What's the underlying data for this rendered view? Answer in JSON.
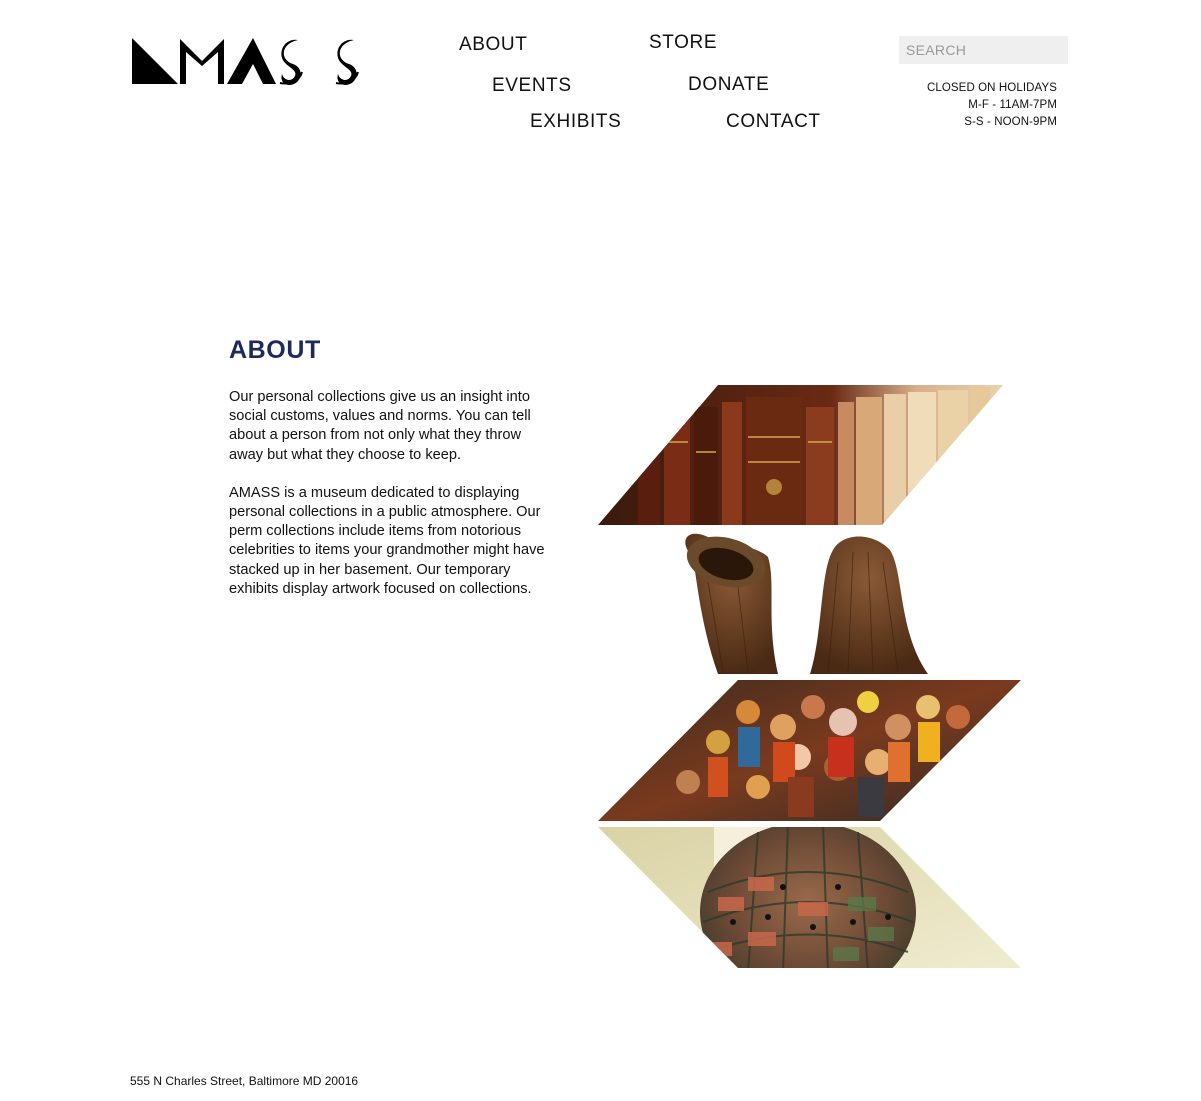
{
  "logo": {
    "text": "AMASS"
  },
  "nav": {
    "about": "ABOUT",
    "store": "STORE",
    "events": "EVENTS",
    "donate": "DONATE",
    "exhibits": "EXHIBITS",
    "contact": "CONTACT"
  },
  "search": {
    "placeholder": "SEARCH",
    "value": ""
  },
  "hours": {
    "line1": "CLOSED ON HOLIDAYS",
    "line2": "M-F - 11AM-7PM",
    "line3": "S-S - NOON-9PM"
  },
  "about": {
    "heading": "ABOUT",
    "paragraph1": "Our personal collections give us an insight into social customs, values and norms. You can tell about a person from not only what they throw away but what they choose to keep.",
    "paragraph2": "AMASS is a museum dedicated to displaying personal collections in a public atmosphere. Our perm collections include items from notorious celebrities to items your grandmother might have stacked up in her basement. Our temporary exhibits display artwork focused on collections."
  },
  "gallery": {
    "images": [
      "books-photo",
      "straw-hats-photo",
      "figurines-photo",
      "sphere-sculpture-photo"
    ]
  },
  "footer": {
    "address": "555 N Charles Street, Baltimore MD 20016"
  },
  "colors": {
    "heading": "#1f2a5c",
    "search_bg": "#efefef",
    "text": "#111111"
  }
}
